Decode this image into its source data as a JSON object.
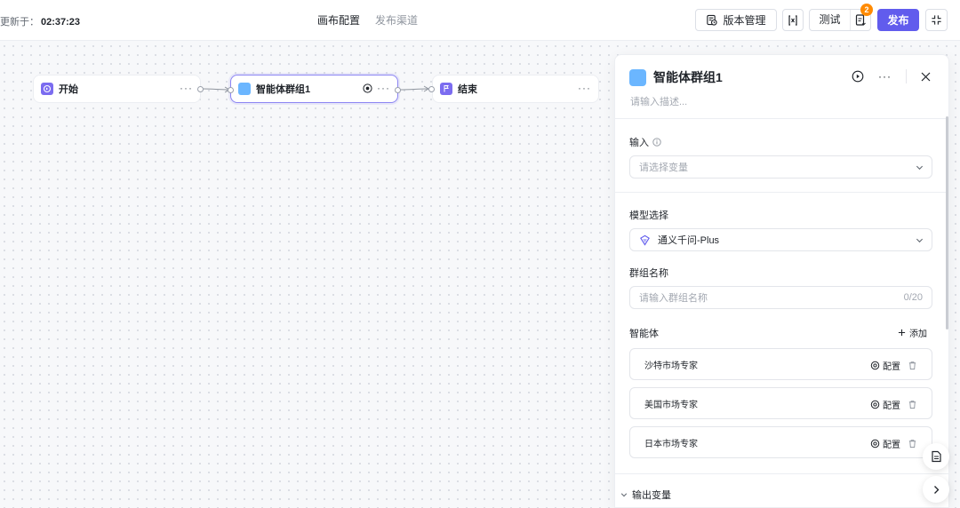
{
  "topbar": {
    "updated_prefix": "更新于：",
    "updated_time": "02:37:23",
    "tabs": [
      {
        "label": "画布配置",
        "active": true
      },
      {
        "label": "发布渠道",
        "active": false
      }
    ],
    "version_label": "版本管理",
    "test_label": "测试",
    "badge_count": "2",
    "publish_label": "发布"
  },
  "canvas": {
    "nodes": [
      {
        "label": "开始",
        "icon": "start-icon"
      },
      {
        "label": "智能体群组1",
        "icon": "group-square-icon",
        "selected": true
      },
      {
        "label": "结束",
        "icon": "end-flag-icon"
      }
    ],
    "more_glyph": "···"
  },
  "panel": {
    "title": "智能体群组1",
    "desc_placeholder": "请输入描述...",
    "input_label": "输入",
    "input_placeholder": "请选择变量",
    "model_label": "模型选择",
    "model_value": "通义千问-Plus",
    "group_name_label": "群组名称",
    "group_name_placeholder": "请输入群组名称",
    "group_name_count": "0/20",
    "agents_label": "智能体",
    "add_label": "添加",
    "config_label": "配置",
    "agents": [
      {
        "name": "沙特市场专家"
      },
      {
        "name": "美国市场专家"
      },
      {
        "name": "日本市场专家"
      }
    ],
    "output_label": "输出变量"
  },
  "colors": {
    "accent": "#615ced",
    "badge": "#ff8a00",
    "group_square": "#6bb6ff",
    "node_icon": "#7b6cf0"
  }
}
